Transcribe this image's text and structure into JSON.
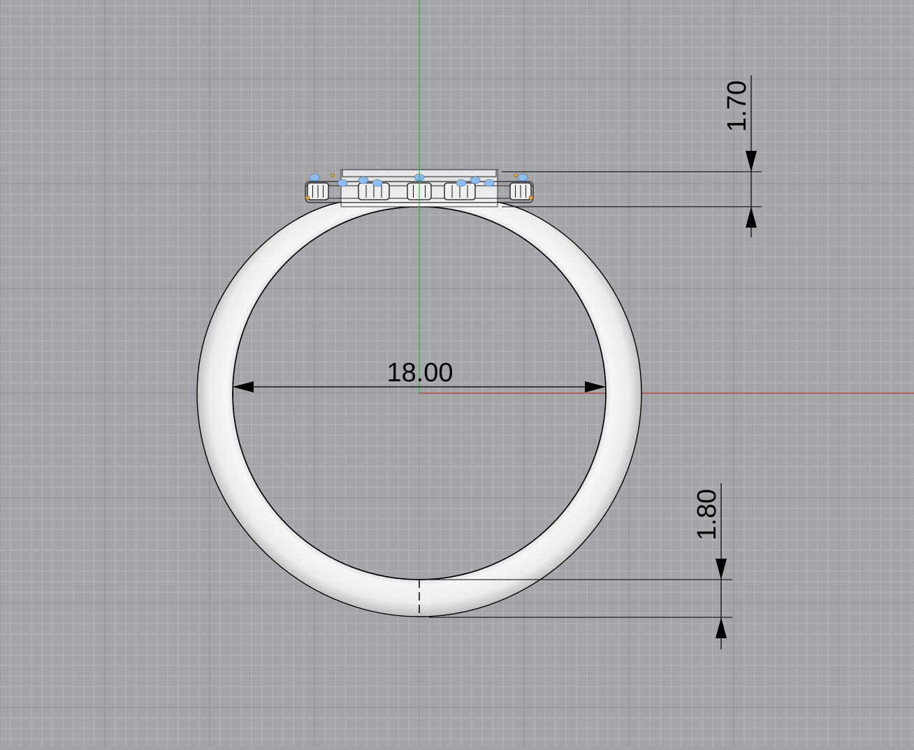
{
  "viewport": {
    "background": "#a3a5a8",
    "grid_minor_color": "#b4b6b9",
    "grid_major_color": "#8f9194",
    "x_axis_color": "#b23a36",
    "y_axis_color": "#3aa84a"
  },
  "model": {
    "ring_color": "#f1f1f1",
    "ring_outline": "#000000",
    "stone_color": "#8cbcf0",
    "prong_color": "#d6a24a"
  },
  "dimensions": {
    "inner_diameter": "18.00",
    "head_height": "1.70",
    "shank_thickness": "1.80"
  }
}
